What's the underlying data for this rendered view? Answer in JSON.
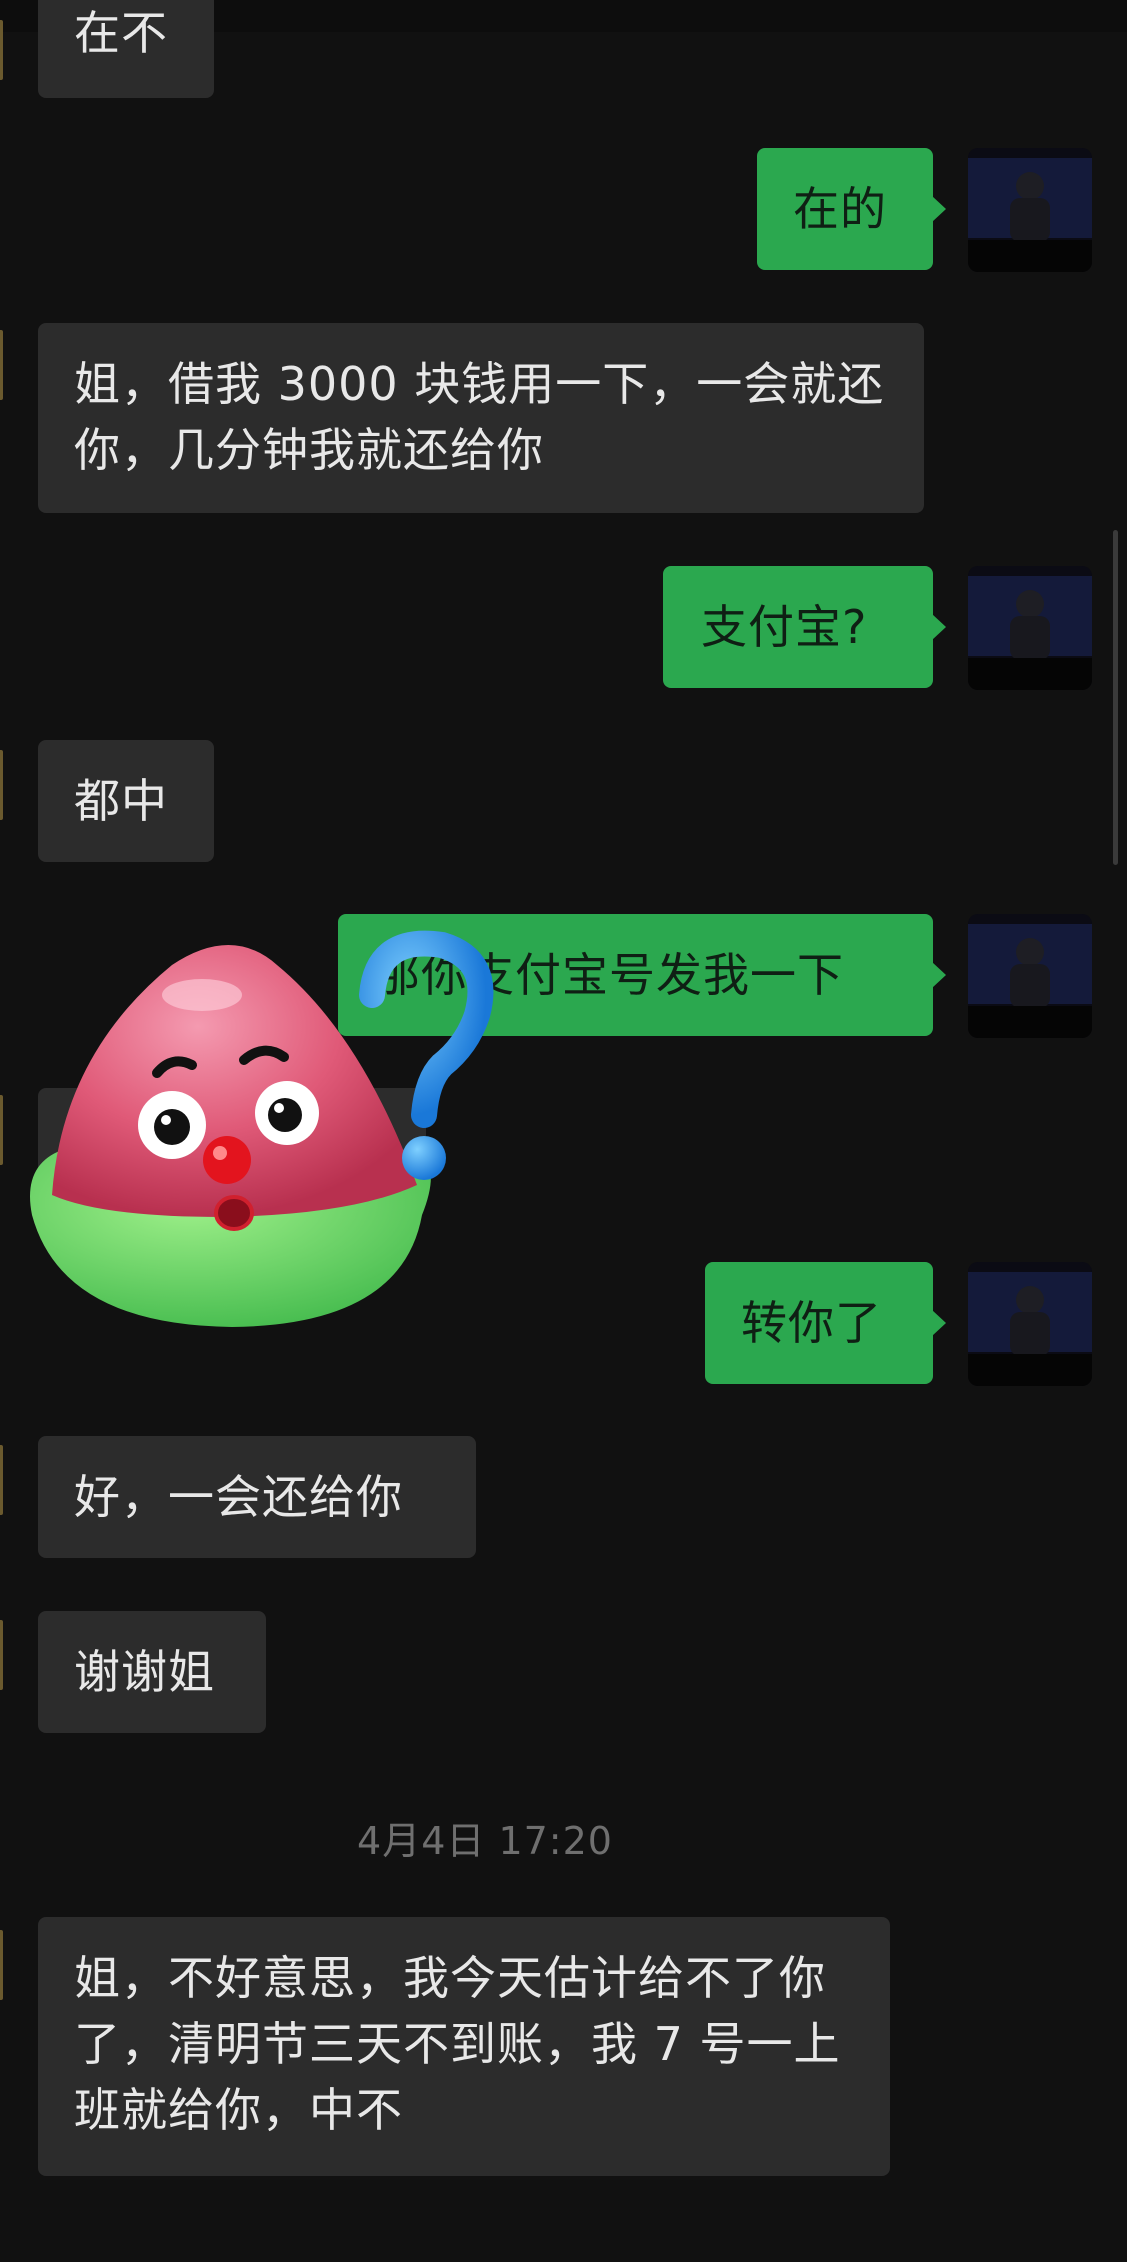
{
  "chat": {
    "messages": [
      {
        "id": "m0",
        "side": "in",
        "text": "在不"
      },
      {
        "id": "m1",
        "side": "out",
        "text": "在的"
      },
      {
        "id": "m2",
        "side": "in",
        "text": "姐，借我 3000 块钱用一下，一会就还你，几分钟我就还给你"
      },
      {
        "id": "m3",
        "side": "out",
        "text": "支付宝?"
      },
      {
        "id": "m4",
        "side": "in",
        "text": "都中"
      },
      {
        "id": "m5",
        "side": "out",
        "text": "那你支付宝号发我一下"
      },
      {
        "id": "m6",
        "side": "in",
        "text": ""
      },
      {
        "id": "m7",
        "side": "out",
        "text": "转你了"
      },
      {
        "id": "m8",
        "side": "in",
        "text": "好，一会还给你"
      },
      {
        "id": "m9",
        "side": "in",
        "text": "谢谢姐"
      },
      {
        "id": "m10",
        "side": "in",
        "text": "姐，不好意思，我今天估计给不了你了，清明节三天不到账，我 7 号一上班就给你，中不"
      }
    ],
    "timestamp": "4月4日 17:20"
  },
  "colors": {
    "background": "#111111",
    "incoming_bubble": "#2c2c2c",
    "outgoing_bubble": "#2ba84f",
    "timestamp_text": "#6f6f6f"
  },
  "sticker": {
    "icon": "watermelon-question-sticker-icon"
  }
}
